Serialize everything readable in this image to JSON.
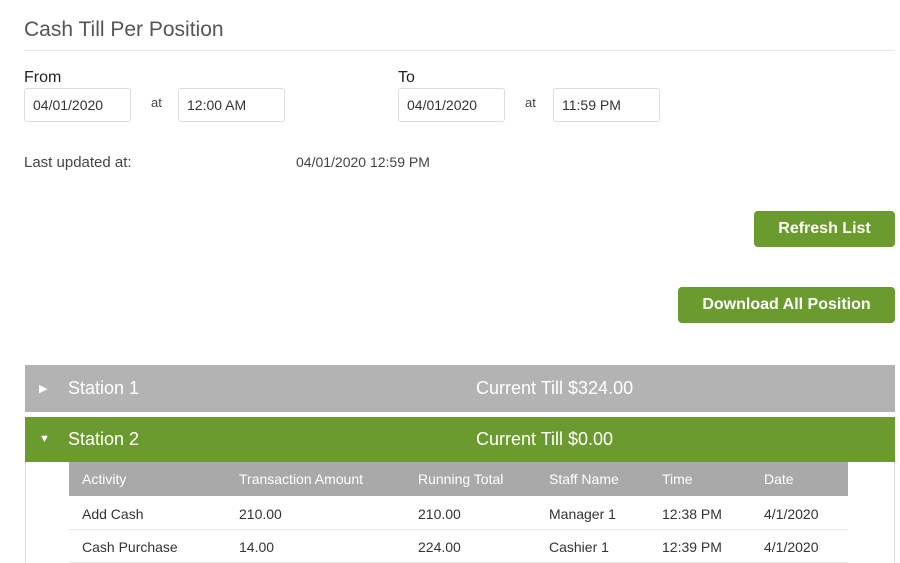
{
  "page_title": "Cash Till Per Position",
  "from": {
    "label": "From",
    "date": "04/01/2020",
    "at_label": "at",
    "time": "12:00 AM"
  },
  "to": {
    "label": "To",
    "date": "04/01/2020",
    "at_label": "at",
    "time": "11:59 PM"
  },
  "last_updated": {
    "label": "Last updated at:",
    "value": "04/01/2020 12:59 PM"
  },
  "buttons": {
    "refresh": "Refresh List",
    "download": "Download All Position"
  },
  "colors": {
    "accent": "#6b9a2e",
    "collapsed_panel": "#b3b3b3",
    "table_header": "#a9a9a9"
  },
  "stations": [
    {
      "name": "Station 1",
      "till": "Current Till $324.00",
      "expanded": false,
      "icon": "caret-right-icon"
    },
    {
      "name": "Station 2",
      "till": "Current Till $0.00",
      "expanded": true,
      "icon": "caret-down-icon"
    }
  ],
  "table": {
    "headers": [
      "Activity",
      "Transaction Amount",
      "Running Total",
      "Staff Name",
      "Time",
      "Date"
    ],
    "rows": [
      [
        "Add Cash",
        "210.00",
        "210.00",
        "Manager 1",
        "12:38 PM",
        "4/1/2020"
      ],
      [
        "Cash Purchase",
        "14.00",
        "224.00",
        "Cashier 1",
        "12:39 PM",
        "4/1/2020"
      ]
    ]
  }
}
